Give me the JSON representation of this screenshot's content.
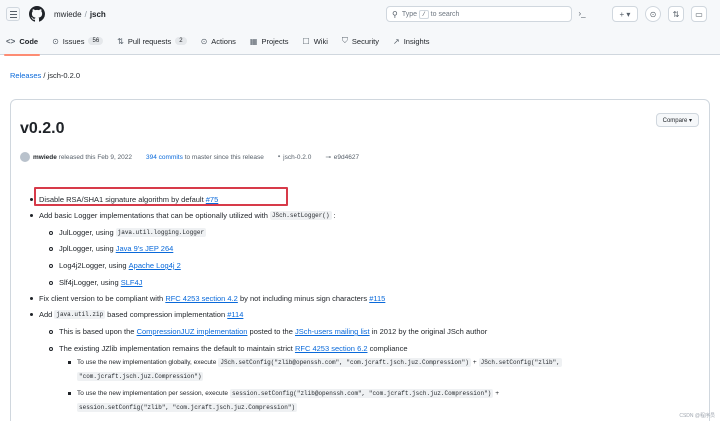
{
  "header": {
    "owner": "mwiede",
    "separator": "/",
    "repo": "jsch",
    "search_pre": "Type",
    "search_key": "/",
    "search_post": "to search",
    "command_icon": "terminal-icon",
    "plus_label": "+ ▾",
    "issues_icon": "issue-icon",
    "pr_icon": "pr-icon",
    "inbox_icon": "inbox-icon"
  },
  "tabs": [
    {
      "icon": "code-icon",
      "glyph": "<>",
      "label": "Code",
      "active": true
    },
    {
      "icon": "issue-icon",
      "glyph": "⊙",
      "label": "Issues",
      "count": "56"
    },
    {
      "icon": "pr-icon",
      "glyph": "⇅",
      "label": "Pull requests",
      "count": "2"
    },
    {
      "icon": "play-icon",
      "glyph": "⊙",
      "label": "Actions"
    },
    {
      "icon": "table-icon",
      "glyph": "▦",
      "label": "Projects"
    },
    {
      "icon": "book-icon",
      "glyph": "☐",
      "label": "Wiki"
    },
    {
      "icon": "shield-icon",
      "glyph": "⛉",
      "label": "Security"
    },
    {
      "icon": "graph-icon",
      "glyph": "↗",
      "label": "Insights"
    }
  ],
  "breadcrumb": {
    "releases": "Releases",
    "sep": " / ",
    "current": "jsch-0.2.0"
  },
  "release": {
    "title": "v0.2.0",
    "compare": "Compare ▾",
    "author": "mwiede",
    "released": "released this Feb 9, 2022",
    "commits": "394 commits",
    "commits_suffix": "to master since this release",
    "tag": "jsch-0.2.0",
    "commit": "e9d4627"
  },
  "notes": {
    "l1_text": "Disable RSA/SHA1 signature algorithm by default",
    "l1_link": "#75",
    "l2_text": "Add basic Logger implementations that can be optionally utilized with",
    "l2_code": "JSch.setLogger()",
    "l2_end": ":",
    "l3_text": "JulLogger, using",
    "l3_code": "java.util.logging.Logger",
    "l4_text": "JplLogger, using",
    "l4_link": "Java 9's JEP 264",
    "l5_text": "Log4j2Logger, using",
    "l5_link": "Apache Log4j 2",
    "l6_text": "Slf4jLogger, using",
    "l6_link": "SLF4J",
    "l7_text": "Fix client version to be compliant with",
    "l7_link": "RFC 4253 section 4.2",
    "l7_mid": "by not including minus sign characters",
    "l7_link2": "#115",
    "l8_text": "Add",
    "l8_code": "java.util.zip",
    "l8_mid": "based compression implementation",
    "l8_link": "#114",
    "l9_text": "This is based upon the",
    "l9_link": "CompressionJUZ implementation",
    "l9_mid": "posted to the",
    "l9_link2": "JSch-users mailing list",
    "l9_end": "in 2012 by the original JSch author",
    "l10_text": "The existing JZlib implementation remains the default to maintain strict",
    "l10_link": "RFC 4253 section 6.2",
    "l10_end": "compliance",
    "l11_text": "To use the new implementation globally, execute",
    "l11_code": "JSch.setConfig(\"zlib@openssh.com\", \"com.jcraft.jsch.juz.Compression\")",
    "l11_plus": "+",
    "l11_code2": "JSch.setConfig(\"zlib\",",
    "l12_code": "\"com.jcraft.jsch.juz.Compression\")",
    "l13_text": "To use the new implementation per session, execute",
    "l13_code": "session.setConfig(\"zlib@openssh.com\", \"com.jcraft.jsch.juz.Compression\")",
    "l13_plus": "+",
    "l14_code": "session.setConfig(\"zlib\", \"com.jcraft.jsch.juz.Compression\")"
  },
  "watermark": "CSDN @程序员",
  "colors": {
    "accent": "#0969da",
    "highlight_box": "#d73a49",
    "tab_underline": "#fd8c73"
  }
}
